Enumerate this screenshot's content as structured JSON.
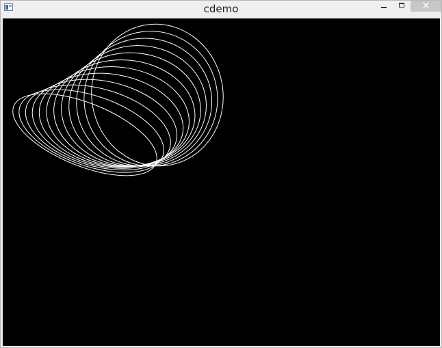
{
  "window": {
    "title": "cdemo",
    "icons": {
      "app": "app-window-icon",
      "minimize": "minimize-icon",
      "maximize": "maximize-icon",
      "close": "close-icon"
    },
    "close_glyph": "✕"
  },
  "canvas": {
    "background": "#000000",
    "stroke": "#ffffff"
  }
}
